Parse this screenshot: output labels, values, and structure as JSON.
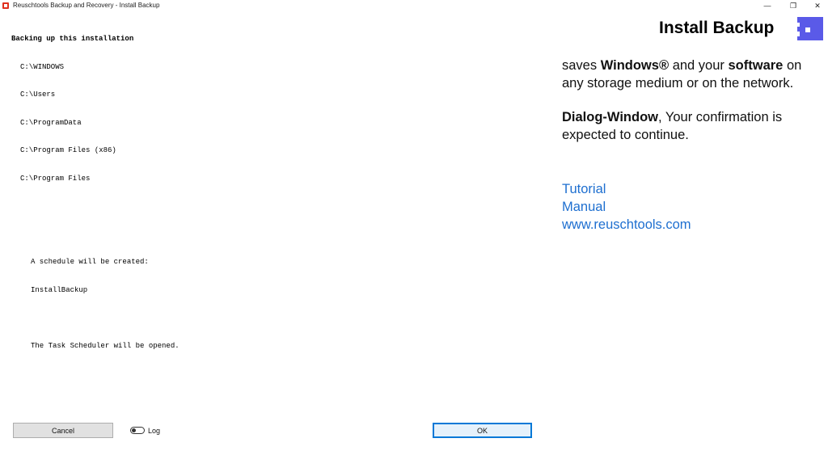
{
  "window": {
    "title": "Reuschtools Backup and Recovery - Install Backup",
    "minimize_glyph": "—",
    "restore_glyph": "❐",
    "close_glyph": "✕"
  },
  "log": {
    "heading": "Backing up this installation",
    "paths": [
      "C:\\WINDOWS",
      "C:\\Users",
      "C:\\ProgramData",
      "C:\\Program Files (x86)",
      "C:\\Program Files"
    ],
    "schedule_line": "A schedule will be created:",
    "schedule_name": "InstallBackup",
    "scheduler_line": "The Task Scheduler will be opened."
  },
  "info": {
    "title": "Install Backup",
    "p1_a": "saves ",
    "p1_b": "Windows®",
    "p1_c": " and your ",
    "p1_d": "software",
    "p1_e": " on any storage medium or on the network.",
    "p2_a": "Dialog-Window",
    "p2_b": ", Your confirmation is expected to continue.",
    "links": [
      "Tutorial",
      "Manual",
      "www.reuschtools.com"
    ]
  },
  "footer": {
    "cancel_label": "Cancel",
    "log_label": "Log",
    "log_toggle_on": false,
    "ok_label": "OK"
  },
  "colors": {
    "link": "#1e6fd0",
    "logo": "#5a5ae8",
    "ok_border": "#0078d7"
  }
}
